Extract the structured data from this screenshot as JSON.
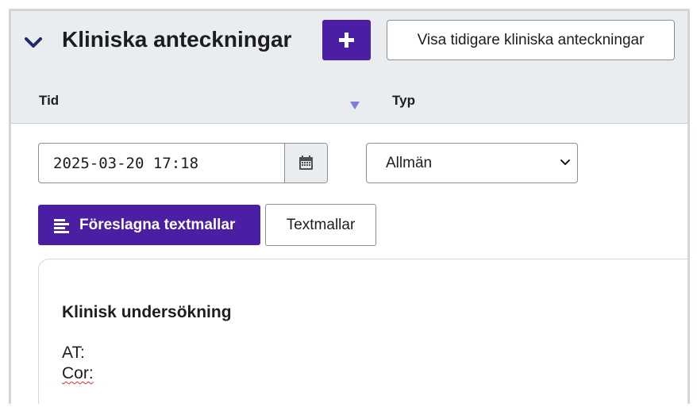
{
  "section": {
    "title": "Kliniska anteckningar",
    "history_button": "Visa tidigare kliniska anteckningar"
  },
  "columns": {
    "time": "Tid",
    "type": "Typ"
  },
  "note": {
    "datetime": "2025-03-20 17:18",
    "type": "Allmän"
  },
  "templates": {
    "suggested_label": "Föreslagna textmallar",
    "templates_label": "Textmallar"
  },
  "editor": {
    "heading": "Klinisk undersökning",
    "line1": "AT:",
    "line2": "Cor:"
  },
  "icons": {
    "collapse": "chevron-down-icon",
    "add": "plus-icon",
    "sort": "sort-down-icon",
    "calendar": "calendar-icon",
    "select": "chevron-down-icon",
    "suggested": "text-lines-icon"
  },
  "colors": {
    "primary": "#4a1fa3",
    "header_bg": "#eaedf0",
    "sort_icon": "#7b7fd6"
  }
}
